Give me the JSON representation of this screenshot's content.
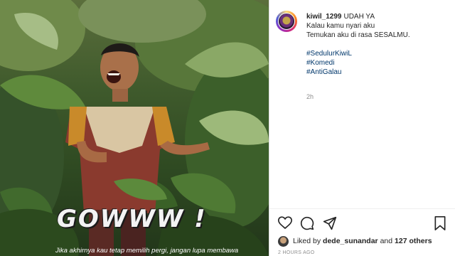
{
  "post": {
    "overlay_title": "GOWWW !",
    "overlay_caption": "Jika akhirnya kau tetap memilih pergi, jangan lupa membawa"
  },
  "panel": {
    "username": "kiwil_1299",
    "caption_lines": [
      "UDAH YA",
      "Kalau kamu nyari aku",
      "Temukan aku di rasa SESALMU."
    ],
    "hashtags": [
      "#SedulurKiwiL",
      "#Komedi",
      "#AntiGalau"
    ],
    "time": "2h",
    "liked_prefix": "Liked by",
    "liked_user": "dede_sunandar",
    "liked_and": "and",
    "liked_others": "127 others",
    "timestamp": "2 HOURS AGO"
  },
  "icons": [
    "heart-icon",
    "comment-icon",
    "share-icon",
    "bookmark-icon"
  ],
  "colors": {
    "hashtag": "#00376b",
    "text": "#262626",
    "muted": "#8e8e8e"
  }
}
